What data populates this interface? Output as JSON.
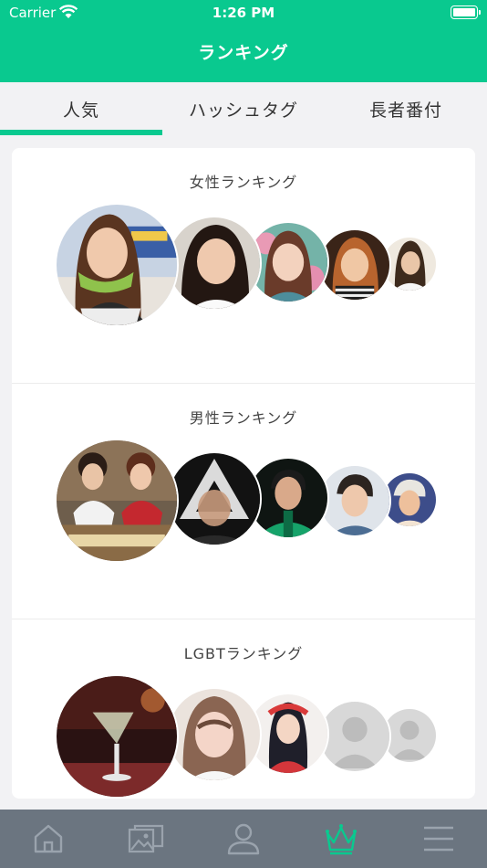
{
  "status": {
    "carrier": "Carrier",
    "time": "1:26 PM"
  },
  "nav": {
    "title": "ランキング"
  },
  "tabs": [
    {
      "label": "人気",
      "active": true
    },
    {
      "label": "ハッシュタグ",
      "active": false
    },
    {
      "label": "長者番付",
      "active": false
    }
  ],
  "sections": [
    {
      "heading": "女性ランキング"
    },
    {
      "heading": "男性ランキング"
    },
    {
      "heading": "LGBTランキング"
    }
  ],
  "tab_bar": {
    "items": [
      "home-icon",
      "gallery-icon",
      "profile-icon",
      "crown-icon",
      "menu-icon"
    ],
    "active": "crown-icon"
  },
  "colors": {
    "accent": "#09c98f",
    "tab_bar_bg": "#6b7580",
    "tab_bar_icon": "#9aa3ad"
  }
}
